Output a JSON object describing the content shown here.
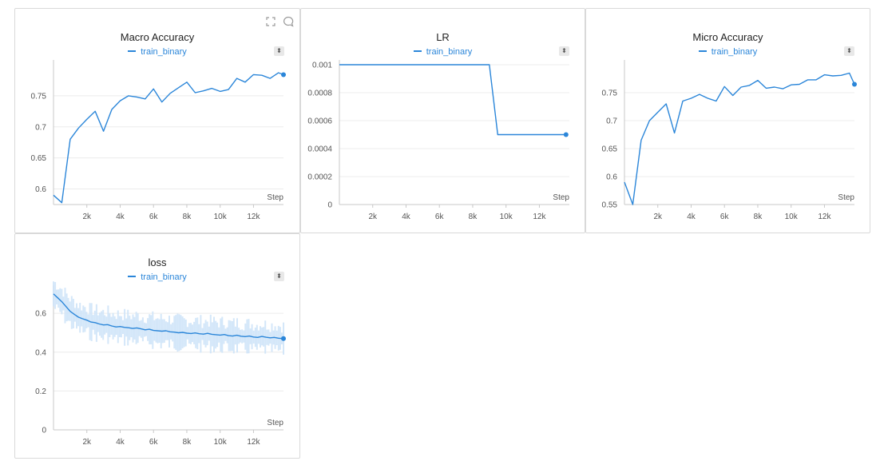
{
  "colors": {
    "series": "#2b86d9",
    "band": "#cfe4f8",
    "grid": "#ececec",
    "axis": "#c8c8c8",
    "panel_border": "#d9d9d9"
  },
  "panel_tools": {
    "fullscreen_icon": "fullscreen-icon",
    "comment_icon": "comment-icon"
  },
  "chart_data": [
    {
      "type": "line",
      "title": "Macro Accuracy",
      "xlabel": "Step",
      "ylabel": "",
      "legend": [
        "train_binary"
      ],
      "legend_placement": "top-center",
      "xlim": [
        0,
        13800
      ],
      "ylim": [
        0.575,
        0.8
      ],
      "x_ticks": [
        2000,
        4000,
        6000,
        8000,
        10000,
        12000
      ],
      "x_tick_labels": [
        "2k",
        "4k",
        "6k",
        "8k",
        "10k",
        "12k"
      ],
      "y_ticks": [
        0.6,
        0.65,
        0.7,
        0.75
      ],
      "y_tick_labels": [
        "0.6",
        "0.65",
        "0.7",
        "0.75"
      ],
      "grid": true,
      "series": [
        {
          "name": "train_binary",
          "x": [
            0,
            500,
            1000,
            1500,
            2000,
            2500,
            3000,
            3500,
            4000,
            4500,
            5000,
            5500,
            6000,
            6500,
            7000,
            7500,
            8000,
            8500,
            9000,
            9500,
            10000,
            10500,
            11000,
            11500,
            12000,
            12500,
            13000,
            13500,
            13800
          ],
          "y": [
            0.59,
            0.578,
            0.68,
            0.698,
            0.712,
            0.725,
            0.693,
            0.728,
            0.742,
            0.75,
            0.748,
            0.745,
            0.761,
            0.74,
            0.754,
            0.763,
            0.772,
            0.755,
            0.758,
            0.762,
            0.757,
            0.76,
            0.778,
            0.772,
            0.784,
            0.783,
            0.778,
            0.787,
            0.784
          ]
        }
      ]
    },
    {
      "type": "line",
      "title": "LR",
      "xlabel": "Step",
      "ylabel": "",
      "legend": [
        "train_binary"
      ],
      "legend_placement": "top-center",
      "xlim": [
        0,
        13800
      ],
      "ylim": [
        0,
        0.001
      ],
      "x_ticks": [
        2000,
        4000,
        6000,
        8000,
        10000,
        12000
      ],
      "x_tick_labels": [
        "2k",
        "4k",
        "6k",
        "8k",
        "10k",
        "12k"
      ],
      "y_ticks": [
        0,
        0.0002,
        0.0004,
        0.0006,
        0.0008,
        0.001
      ],
      "y_tick_labels": [
        "0",
        "0.0002",
        "0.0004",
        "0.0006",
        "0.0008",
        "0.001"
      ],
      "grid": true,
      "series": [
        {
          "name": "train_binary",
          "x": [
            0,
            9000,
            9500,
            13600
          ],
          "y": [
            0.001,
            0.001,
            0.0005,
            0.0005
          ]
        }
      ]
    },
    {
      "type": "line",
      "title": "Micro Accuracy",
      "xlabel": "Step",
      "ylabel": "",
      "legend": [
        "train_binary"
      ],
      "legend_placement": "top-center",
      "xlim": [
        0,
        13800
      ],
      "ylim": [
        0.55,
        0.8
      ],
      "x_ticks": [
        2000,
        4000,
        6000,
        8000,
        10000,
        12000
      ],
      "x_tick_labels": [
        "2k",
        "4k",
        "6k",
        "8k",
        "10k",
        "12k"
      ],
      "y_ticks": [
        0.55,
        0.6,
        0.65,
        0.7,
        0.75
      ],
      "y_tick_labels": [
        "0.55",
        "0.6",
        "0.65",
        "0.7",
        "0.75"
      ],
      "grid": true,
      "series": [
        {
          "name": "train_binary",
          "x": [
            0,
            500,
            1000,
            1500,
            2000,
            2500,
            3000,
            3500,
            4000,
            4500,
            5000,
            5500,
            6000,
            6500,
            7000,
            7500,
            8000,
            8500,
            9000,
            9500,
            10000,
            10500,
            11000,
            11500,
            12000,
            12500,
            13000,
            13500,
            13800
          ],
          "y": [
            0.59,
            0.55,
            0.665,
            0.7,
            0.715,
            0.73,
            0.678,
            0.735,
            0.74,
            0.747,
            0.74,
            0.735,
            0.761,
            0.745,
            0.76,
            0.763,
            0.772,
            0.758,
            0.76,
            0.757,
            0.764,
            0.765,
            0.773,
            0.773,
            0.782,
            0.78,
            0.781,
            0.785,
            0.765
          ]
        }
      ]
    },
    {
      "type": "line",
      "title": "loss",
      "xlabel": "Step",
      "ylabel": "",
      "legend": [
        "train_binary"
      ],
      "legend_placement": "top-center",
      "xlim": [
        0,
        13800
      ],
      "ylim": [
        0,
        0.72
      ],
      "x_ticks": [
        2000,
        4000,
        6000,
        8000,
        10000,
        12000
      ],
      "x_tick_labels": [
        "2k",
        "4k",
        "6k",
        "8k",
        "10k",
        "12k"
      ],
      "y_ticks": [
        0,
        0.2,
        0.4,
        0.6
      ],
      "y_tick_labels": [
        "0",
        "0.2",
        "0.4",
        "0.6"
      ],
      "grid": true,
      "series": [
        {
          "name": "train_binary",
          "x": [
            0,
            250,
            500,
            750,
            1000,
            1250,
            1500,
            1750,
            2000,
            2250,
            2500,
            2750,
            3000,
            3250,
            3500,
            3750,
            4000,
            4250,
            4500,
            4750,
            5000,
            5250,
            5500,
            5750,
            6000,
            6250,
            6500,
            6750,
            7000,
            7250,
            7500,
            7750,
            8000,
            8250,
            8500,
            8750,
            9000,
            9250,
            9500,
            9750,
            10000,
            10250,
            10500,
            10750,
            11000,
            11250,
            11500,
            11750,
            12000,
            12250,
            12500,
            12750,
            13000,
            13250,
            13500,
            13800
          ],
          "y": [
            0.7,
            0.68,
            0.66,
            0.635,
            0.61,
            0.595,
            0.58,
            0.572,
            0.565,
            0.555,
            0.552,
            0.545,
            0.54,
            0.542,
            0.535,
            0.53,
            0.532,
            0.528,
            0.526,
            0.522,
            0.525,
            0.52,
            0.515,
            0.518,
            0.512,
            0.51,
            0.508,
            0.51,
            0.505,
            0.503,
            0.5,
            0.502,
            0.498,
            0.496,
            0.499,
            0.495,
            0.493,
            0.497,
            0.492,
            0.49,
            0.488,
            0.491,
            0.485,
            0.483,
            0.487,
            0.482,
            0.48,
            0.483,
            0.478,
            0.476,
            0.481,
            0.477,
            0.474,
            0.476,
            0.472,
            0.47
          ]
        }
      ]
    }
  ]
}
